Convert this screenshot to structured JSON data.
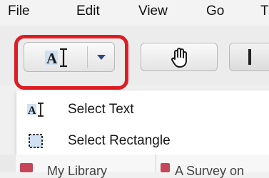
{
  "menubar": {
    "items": [
      {
        "label": "File"
      },
      {
        "label": "Edit"
      },
      {
        "label": "View"
      },
      {
        "label": "Go"
      },
      {
        "label": "T"
      }
    ]
  },
  "toolbar": {
    "tool_icon": "select-text-icon",
    "tool_icon_letter": "A",
    "dropdown_icon": "chevron-down-icon",
    "hand_icon": "hand-icon"
  },
  "dropdown": {
    "items": [
      {
        "label": "Select Text",
        "icon": "select-text-icon",
        "icon_letter": "A"
      },
      {
        "label": "Select Rectangle",
        "icon": "select-rectangle-icon"
      }
    ]
  },
  "tabs": {
    "items": [
      {
        "label": "My Library",
        "icon": "library-icon"
      },
      {
        "label": "A Survey on",
        "icon": "document-icon"
      }
    ]
  },
  "colors": {
    "highlight": "#e11b22",
    "accent": "#2c4a7a",
    "icon_fill": "#cfe1f2"
  }
}
